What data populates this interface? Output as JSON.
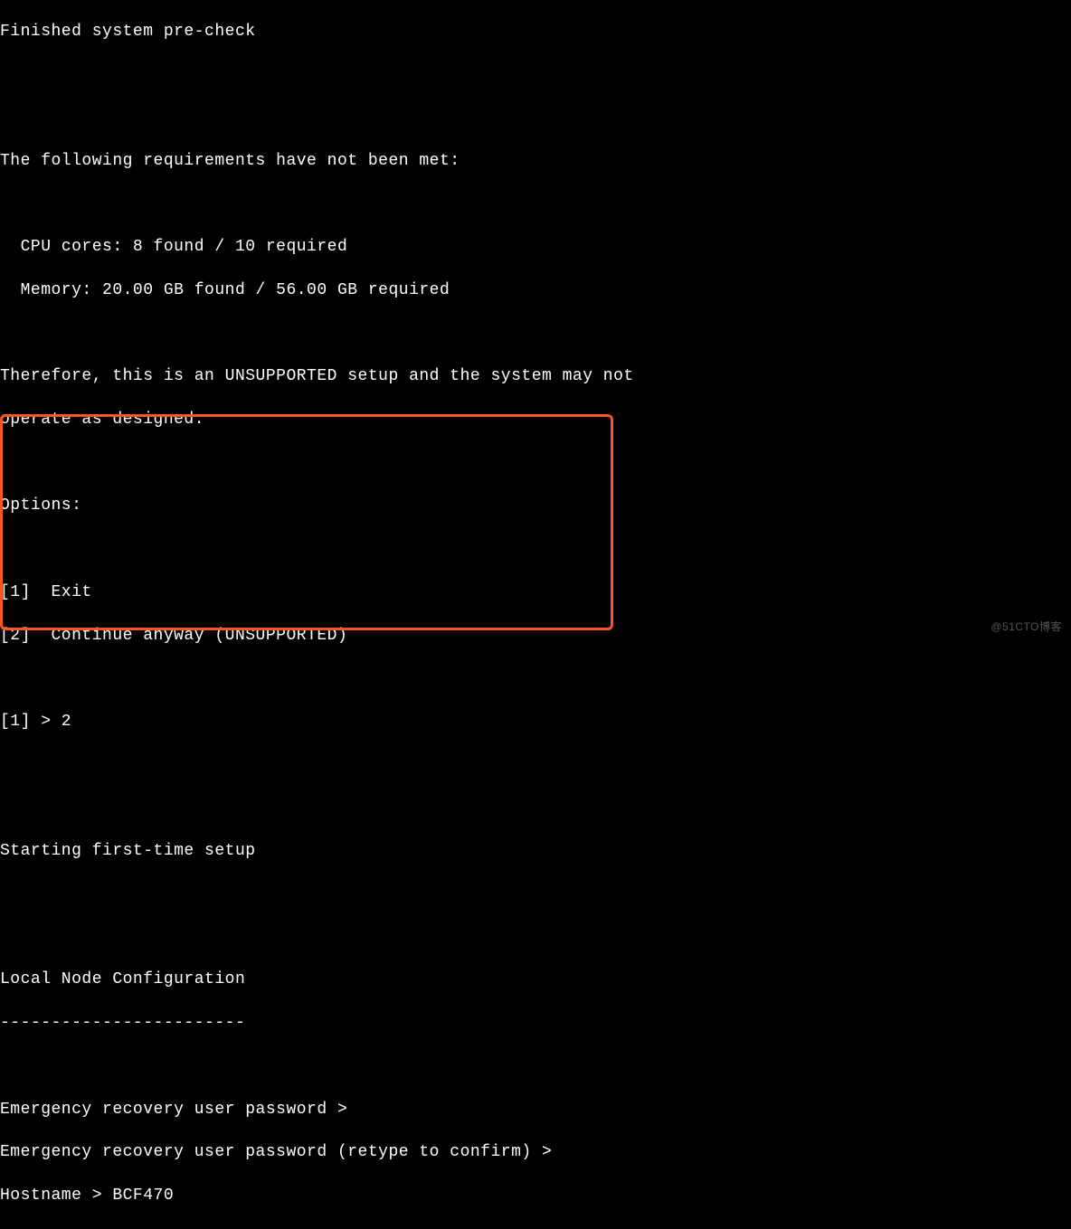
{
  "terminal": {
    "lines": [
      "Finished system pre-check",
      "",
      "",
      "The following requirements have not been met:",
      "",
      "  CPU cores: 8 found / 10 required",
      "  Memory: 20.00 GB found / 56.00 GB required",
      "",
      "Therefore, this is an UNSUPPORTED setup and the system may not",
      "operate as designed.",
      "",
      "Options:",
      "",
      "[1]  Exit",
      "[2]  Continue anyway (UNSUPPORTED)",
      "",
      "[1] > 2",
      "",
      "",
      "Starting first-time setup",
      "",
      "",
      "Local Node Configuration",
      "------------------------",
      "",
      "Emergency recovery user password > ",
      "Emergency recovery user password (retype to confirm) > ",
      "Hostname > BCF470"
    ]
  },
  "watermark": "@51CTO博客"
}
